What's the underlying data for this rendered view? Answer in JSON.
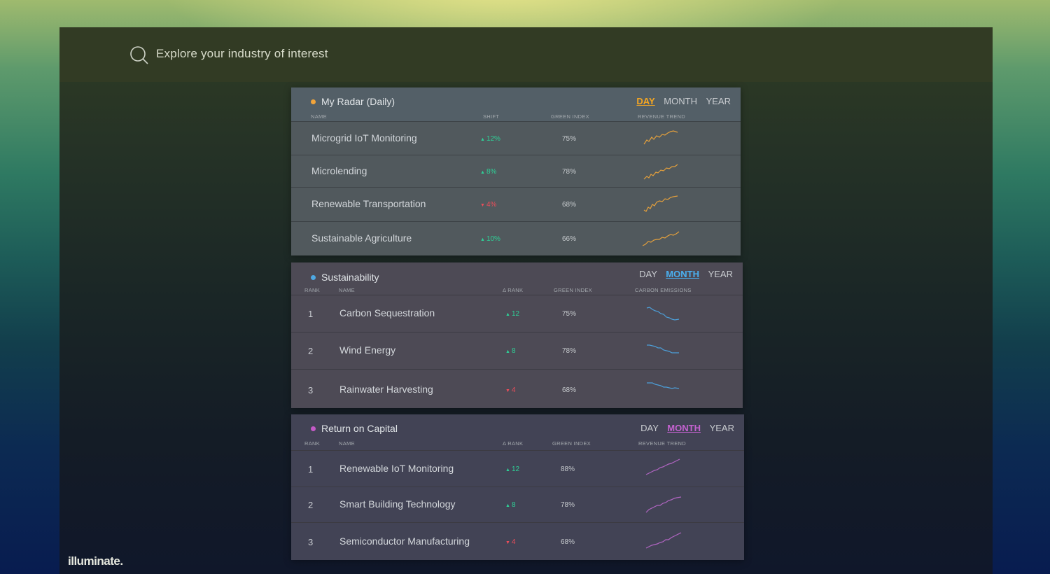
{
  "search": {
    "placeholder": "Explore your industry of interest"
  },
  "brand": "illuminate.",
  "periods": [
    "DAY",
    "MONTH",
    "YEAR"
  ],
  "radar": {
    "title": "My Radar (Daily)",
    "dot_color": "#f2a43a",
    "active_period": "DAY",
    "active_color": "#f4a623",
    "columns": {
      "name": "NAME",
      "shift": "SHIFT",
      "green_index": "GREEN INDEX",
      "trend": "REVENUE TREND"
    },
    "trend_color": "#e4a03c",
    "rows": [
      {
        "name": "Microgrid IoT Monitoring",
        "direction": "up",
        "shift": "12%",
        "green_index": "75%"
      },
      {
        "name": "Microlending",
        "direction": "up",
        "shift": "8%",
        "green_index": "78%"
      },
      {
        "name": "Renewable Transportation",
        "direction": "down",
        "shift": "4%",
        "green_index": "68%"
      },
      {
        "name": "Sustainable Agriculture",
        "direction": "up",
        "shift": "10%",
        "green_index": "66%"
      }
    ]
  },
  "sustainability": {
    "title": "Sustainability",
    "dot_color": "#4ea8e2",
    "active_period": "MONTH",
    "active_color": "#4ab0f0",
    "columns": {
      "rank": "RANK",
      "name": "NAME",
      "delta_rank": "Δ RANK",
      "green_index": "GREEN INDEX",
      "trend": "CARBON EMISSIONS"
    },
    "trend_color": "#4d9fd9",
    "rows": [
      {
        "rank": "1",
        "name": "Carbon Sequestration",
        "direction": "up",
        "delta": "12",
        "green_index": "75%"
      },
      {
        "rank": "2",
        "name": "Wind Energy",
        "direction": "up",
        "delta": "8",
        "green_index": "78%"
      },
      {
        "rank": "3",
        "name": "Rainwater Harvesting",
        "direction": "down",
        "delta": "4",
        "green_index": "68%"
      }
    ]
  },
  "capital": {
    "title": "Return on Capital",
    "dot_color": "#c45ac7",
    "active_period": "MONTH",
    "active_color": "#c462d0",
    "columns": {
      "rank": "RANK",
      "name": "NAME",
      "delta_rank": "Δ RANK",
      "green_index": "GREEN INDEX",
      "trend": "REVENUE TREND"
    },
    "trend_color": "#b265c3",
    "rows": [
      {
        "rank": "1",
        "name": "Renewable IoT Monitoring",
        "direction": "up",
        "delta": "12",
        "green_index": "88%"
      },
      {
        "rank": "2",
        "name": "Smart Building Technology",
        "direction": "up",
        "delta": "8",
        "green_index": "78%"
      },
      {
        "rank": "3",
        "name": "Semiconductor Manufacturing",
        "direction": "down",
        "delta": "4",
        "green_index": "68%"
      }
    ]
  }
}
